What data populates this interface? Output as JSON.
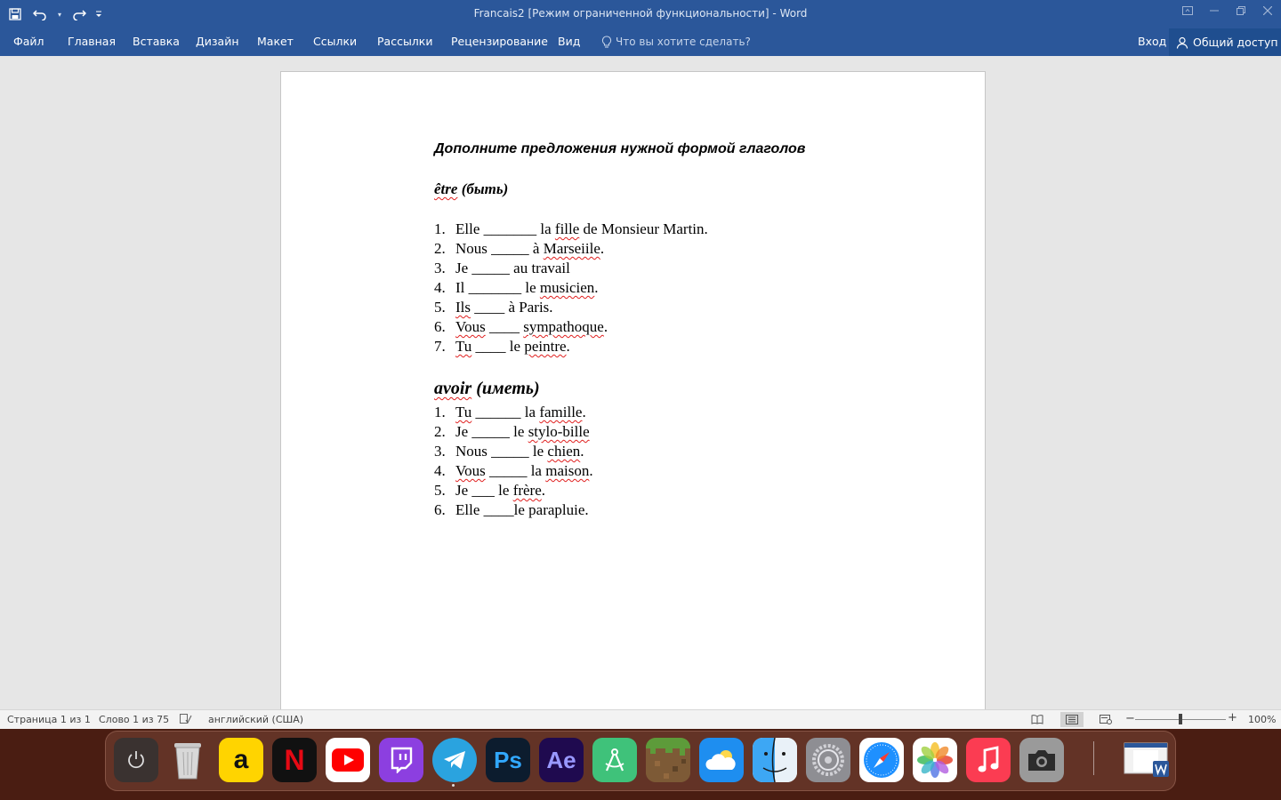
{
  "window": {
    "title": "Francais2 [Режим ограниченной функциональности] - Word"
  },
  "ribbon": {
    "tabs": [
      "Файл",
      "Главная",
      "Вставка",
      "Дизайн",
      "Макет",
      "Ссылки",
      "Рассылки",
      "Рецензирование",
      "Вид"
    ],
    "tell_me": "Что вы хотите сделать?",
    "sign_in": "Вход",
    "share": "Общий доступ"
  },
  "document": {
    "heading": "Дополните предложения нужной формой глаголов",
    "sections": [
      {
        "title_word": "être",
        "title_rest": " (быть)",
        "items": [
          {
            "num": "1.",
            "parts": [
              [
                "Elle _______ la ",
                false
              ],
              [
                "fille",
                true
              ],
              [
                " de Monsieur Martin.",
                false
              ]
            ]
          },
          {
            "num": "2.",
            "parts": [
              [
                "Nous _____ à ",
                false
              ],
              [
                "Marseiile",
                true
              ],
              [
                ".",
                false
              ]
            ]
          },
          {
            "num": "3.",
            "parts": [
              [
                "Je _____ au travail",
                false
              ]
            ]
          },
          {
            "num": "4.",
            "parts": [
              [
                "Il _______ le ",
                false
              ],
              [
                "musicien",
                true
              ],
              [
                ".",
                false
              ]
            ]
          },
          {
            "num": "5.",
            "parts": [
              [
                "Ils",
                true
              ],
              [
                " ____ à Paris.",
                false
              ]
            ]
          },
          {
            "num": "6.",
            "parts": [
              [
                "Vous",
                true
              ],
              [
                " ____ ",
                false
              ],
              [
                "sympathoque",
                true
              ],
              [
                ".",
                false
              ]
            ]
          },
          {
            "num": "7.",
            "parts": [
              [
                "Tu",
                true
              ],
              [
                " ____ le ",
                false
              ],
              [
                "peintre",
                true
              ],
              [
                ".",
                false
              ]
            ]
          }
        ]
      },
      {
        "title_word": "avoir",
        "title_rest": " (иметь)",
        "items": [
          {
            "num": "1.",
            "parts": [
              [
                "Tu",
                true
              ],
              [
                " ______ la ",
                false
              ],
              [
                "famille",
                true
              ],
              [
                ".",
                false
              ]
            ]
          },
          {
            "num": "2.",
            "parts": [
              [
                "Je _____ le ",
                false
              ],
              [
                "stylo-bille",
                true
              ]
            ]
          },
          {
            "num": "3.",
            "parts": [
              [
                "Nous _____ le ",
                false
              ],
              [
                "chien",
                true
              ],
              [
                ".",
                false
              ]
            ]
          },
          {
            "num": "4.",
            "parts": [
              [
                "Vous",
                true
              ],
              [
                " _____ la ",
                false
              ],
              [
                "maison",
                true
              ],
              [
                ".",
                false
              ]
            ]
          },
          {
            "num": "5.",
            "parts": [
              [
                "Je ___ le ",
                false
              ],
              [
                "frère",
                true
              ],
              [
                ".",
                false
              ]
            ]
          },
          {
            "num": "6.",
            "parts": [
              [
                "Elle ____le parapluie.",
                false
              ]
            ]
          }
        ]
      }
    ]
  },
  "status": {
    "page": "Страница 1 из 1",
    "words": "Слово 1 из 75",
    "language": "английский (США)",
    "zoom": "100%"
  },
  "dock": {
    "apps": [
      "power",
      "trash",
      "amazon",
      "netflix",
      "youtube",
      "twitch",
      "telegram",
      "photoshop",
      "after-effects",
      "instruments",
      "minecraft",
      "weather",
      "finder",
      "system-preferences",
      "safari",
      "photos",
      "music",
      "screenshot",
      "word-window"
    ],
    "labels": {
      "amazon": "a",
      "netflix": "N",
      "photoshop": "Ps",
      "after-effects": "Ae"
    }
  },
  "colors": {
    "titlebar": "#2b579a",
    "share": "#1f4e8f",
    "dock": "#4a1d12"
  }
}
